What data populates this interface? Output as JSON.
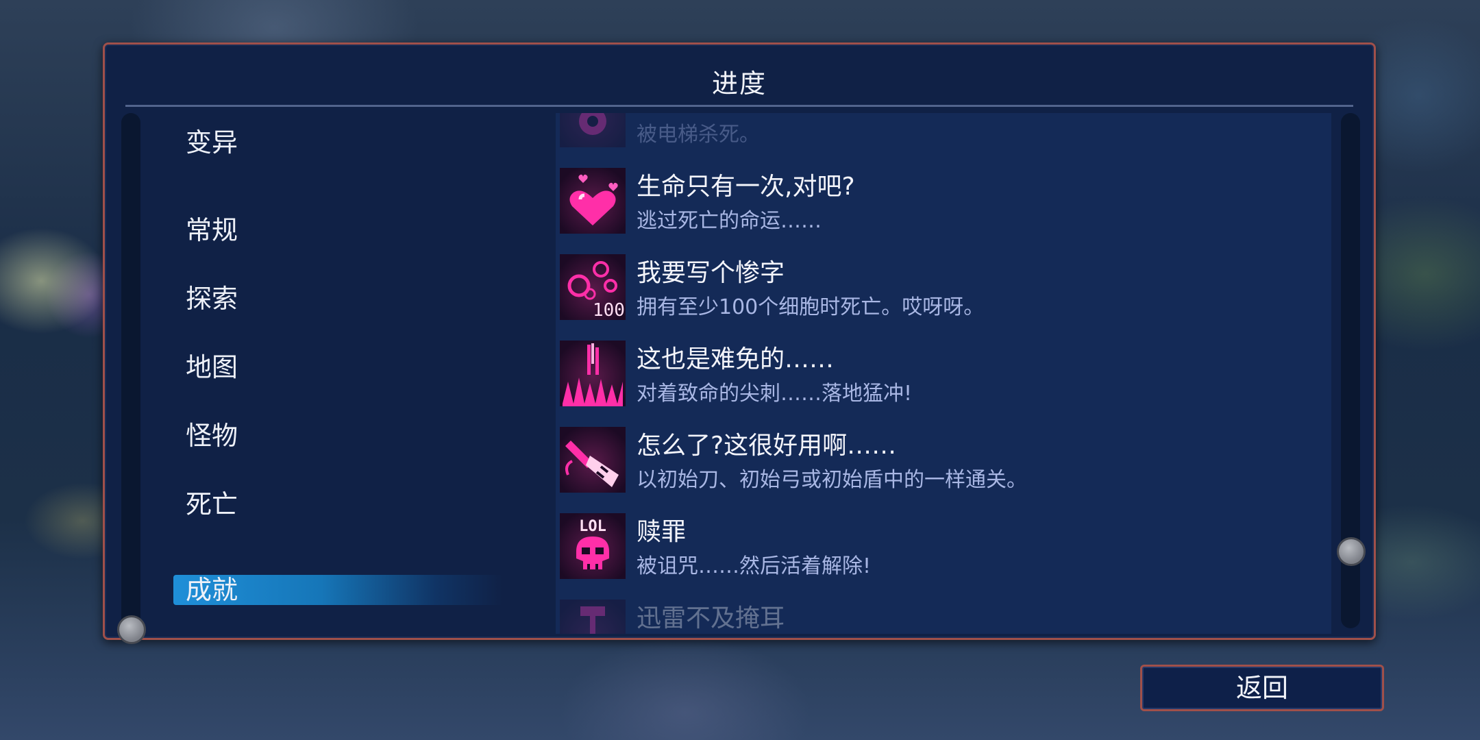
{
  "panel": {
    "title": "进度"
  },
  "categories": [
    {
      "label": "变异",
      "selected": false
    },
    {
      "label": "常规",
      "selected": false
    },
    {
      "label": "探索",
      "selected": false
    },
    {
      "label": "地图",
      "selected": false
    },
    {
      "label": "怪物",
      "selected": false
    },
    {
      "label": "死亡",
      "selected": false
    },
    {
      "label": "成就",
      "selected": true
    }
  ],
  "achievements": [
    {
      "icon": "elevator-icon",
      "title": "",
      "desc": "被电梯杀死。"
    },
    {
      "icon": "hearts-icon",
      "title": "生命只有一次,对吧?",
      "desc": "逃过死亡的命运……"
    },
    {
      "icon": "cells-100-icon",
      "title": "我要写个惨字",
      "desc": "拥有至少100个细胞时死亡。哎呀呀。"
    },
    {
      "icon": "spikes-icon",
      "title": "这也是难免的……",
      "desc": "对着致命的尖刺……落地猛冲!"
    },
    {
      "icon": "starter-weapons-icon",
      "title": "怎么了?这很好用啊……",
      "desc": "以初始刀、初始弓或初始盾中的一样通关。"
    },
    {
      "icon": "lol-skull-icon",
      "title": "赎罪",
      "desc": "被诅咒……然后活着解除!"
    },
    {
      "icon": "hammer-icon",
      "title": "迅雷不及掩耳",
      "desc": ""
    }
  ],
  "icon_text": {
    "cells_count": "100",
    "skull_caption": "LOL"
  },
  "footer": {
    "back_label": "返回"
  },
  "colors": {
    "panel_bg": "#102146",
    "panel_border": "#a0504a",
    "selected_tab": "#1f8fd8",
    "icon_magenta": "#ff2fa8",
    "desc_text": "#a9b7e4"
  }
}
